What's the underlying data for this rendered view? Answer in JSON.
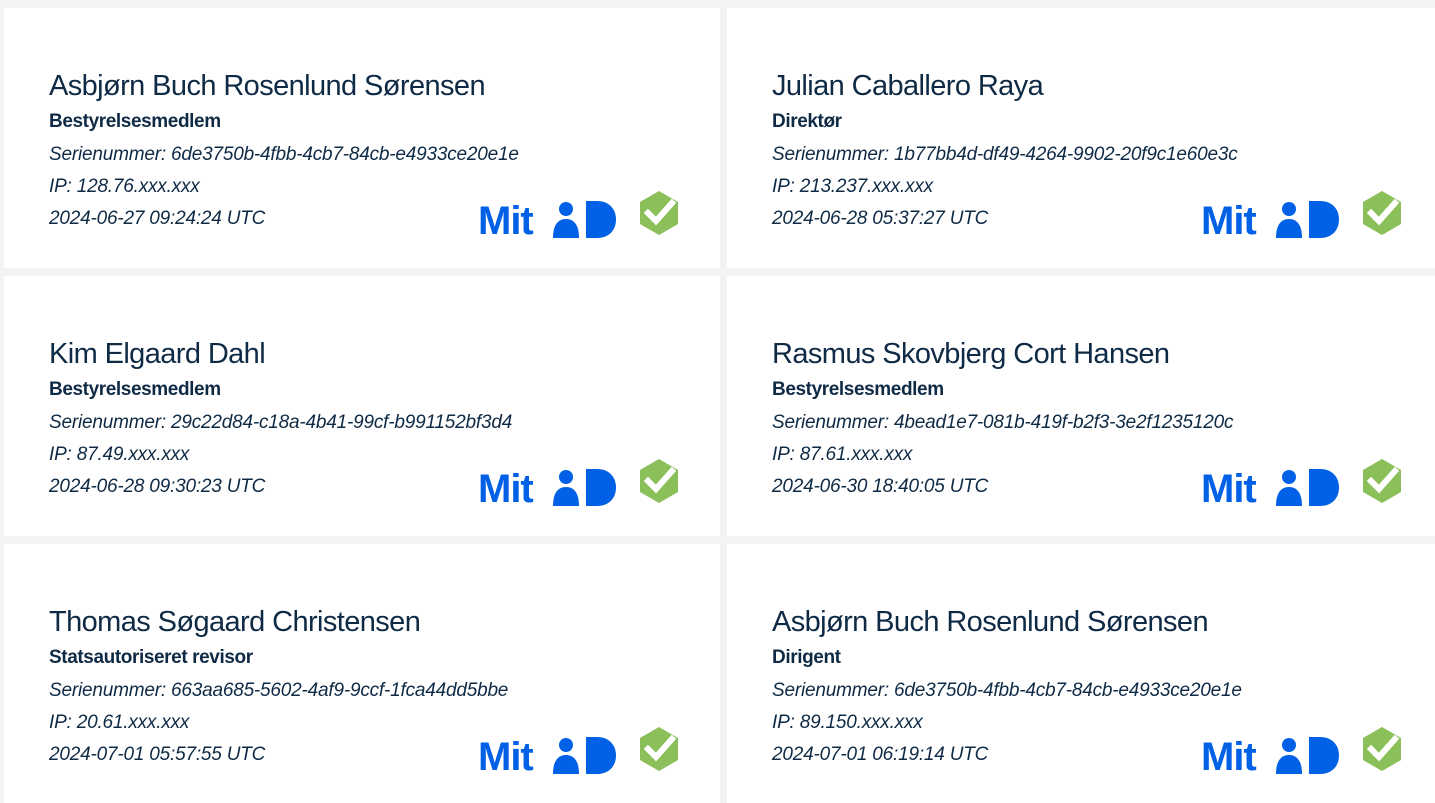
{
  "signatures": [
    {
      "name": "Asbjørn Buch Rosenlund Sørensen",
      "role": "Bestyrelsesmedlem",
      "serial": "Serienummer: 6de3750b-4fbb-4cb7-84cb-e4933ce20e1e",
      "ip": "IP: 128.76.xxx.xxx",
      "timestamp": "2024-06-27 09:24:24 UTC"
    },
    {
      "name": "Julian Caballero Raya",
      "role": "Direktør",
      "serial": "Serienummer: 1b77bb4d-df49-4264-9902-20f9c1e60e3c",
      "ip": "IP: 213.237.xxx.xxx",
      "timestamp": "2024-06-28 05:37:27 UTC"
    },
    {
      "name": "Kim Elgaard Dahl",
      "role": "Bestyrelsesmedlem",
      "serial": "Serienummer: 29c22d84-c18a-4b41-99cf-b991152bf3d4",
      "ip": "IP: 87.49.xxx.xxx",
      "timestamp": "2024-06-28 09:30:23 UTC"
    },
    {
      "name": "Rasmus Skovbjerg Cort Hansen",
      "role": "Bestyrelsesmedlem",
      "serial": "Serienummer: 4bead1e7-081b-419f-b2f3-3e2f1235120c",
      "ip": "IP: 87.61.xxx.xxx",
      "timestamp": "2024-06-30 18:40:05 UTC"
    },
    {
      "name": "Thomas Søgaard Christensen",
      "role": "Statsautoriseret revisor",
      "serial": "Serienummer: 663aa685-5602-4af9-9ccf-1fca44dd5bbe",
      "ip": "IP: 20.61.xxx.xxx",
      "timestamp": "2024-07-01 05:57:55 UTC"
    },
    {
      "name": "Asbjørn Buch Rosenlund Sørensen",
      "role": "Dirigent",
      "serial": "Serienummer: 6de3750b-4fbb-4cb7-84cb-e4933ce20e1e",
      "ip": "IP: 89.150.xxx.xxx",
      "timestamp": "2024-07-01 06:19:14 UTC"
    }
  ],
  "logo": {
    "text": "Mit",
    "icon": "mitid-logo",
    "color": "#0060e6"
  },
  "verified_icon": {
    "icon": "verified-check-icon",
    "color": "#8bbf5a"
  }
}
